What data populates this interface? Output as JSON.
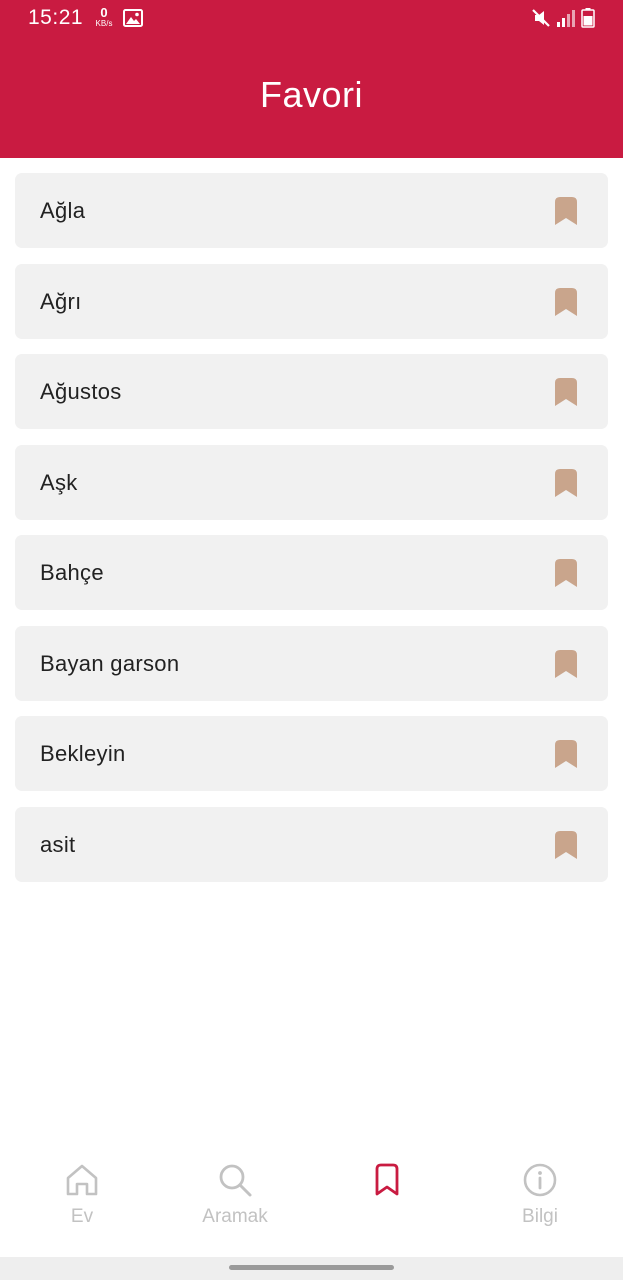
{
  "status_bar": {
    "time": "15:21",
    "net_speed_value": "0",
    "net_speed_unit": "KB/s",
    "icons": [
      "gallery-icon",
      "mute-icon",
      "signal-icon",
      "battery-icon"
    ]
  },
  "header": {
    "title": "Favori",
    "background_color": "#c91b41"
  },
  "favorites": [
    {
      "label": "Ağla"
    },
    {
      "label": "Ağrı"
    },
    {
      "label": "Ağustos"
    },
    {
      "label": "Aşk"
    },
    {
      "label": "Bahçe"
    },
    {
      "label": "Bayan garson"
    },
    {
      "label": "Bekleyin"
    },
    {
      "label": "asit"
    }
  ],
  "bookmark_color": "#c9a58c",
  "bottom_nav": {
    "items": [
      {
        "label": "Ev",
        "icon": "home-icon",
        "active": false
      },
      {
        "label": "Aramak",
        "icon": "search-icon",
        "active": false
      },
      {
        "label": "",
        "icon": "bookmark-icon",
        "active": true
      },
      {
        "label": "Bilgi",
        "icon": "info-icon",
        "active": false
      }
    ],
    "active_color": "#c91b41",
    "inactive_color": "#c2c2c2"
  }
}
